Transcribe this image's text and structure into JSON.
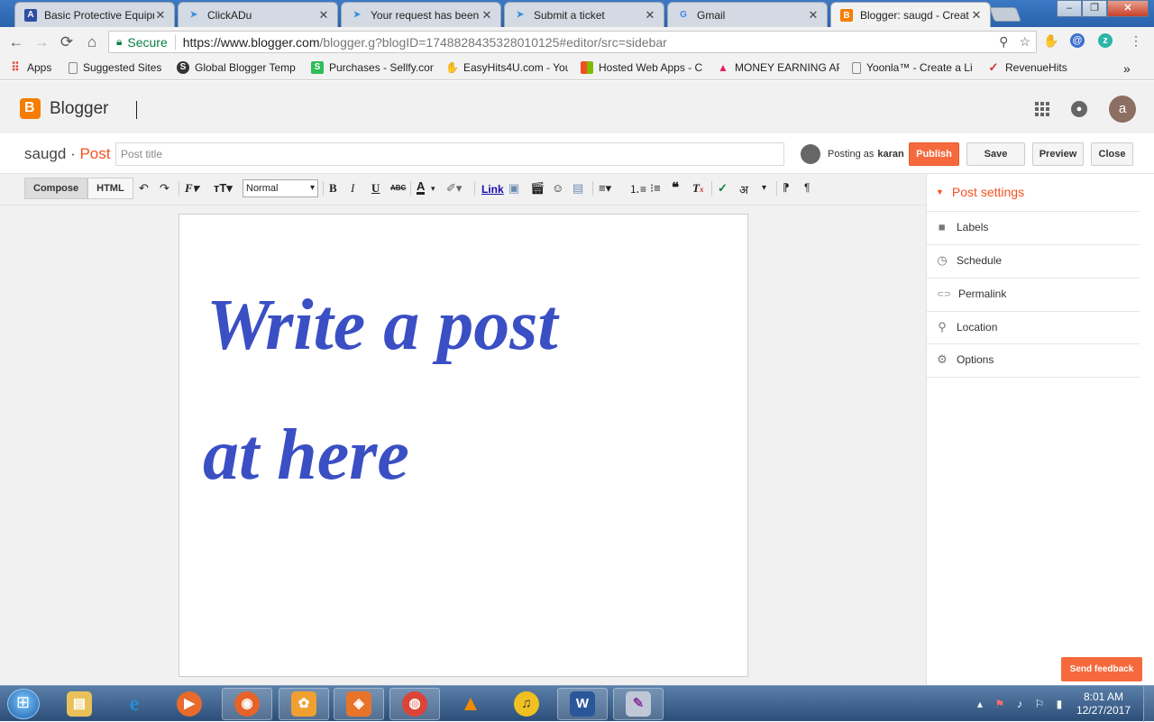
{
  "browser": {
    "tabs": [
      {
        "label": "Basic Protective Equipm",
        "icon": "A",
        "color": "#2c4ea3",
        "active": false
      },
      {
        "label": "ClickADu",
        "icon": "➤",
        "color": "#3a8fd9",
        "active": false
      },
      {
        "label": "Your request has been",
        "icon": "➤",
        "color": "#3a8fd9",
        "active": false
      },
      {
        "label": "Submit a ticket",
        "icon": "➤",
        "color": "#3a8fd9",
        "active": false
      },
      {
        "label": "Gmail",
        "icon": "G",
        "color": "#4285f4",
        "active": false
      },
      {
        "label": "Blogger: saugd - Creat",
        "icon": "B",
        "color": "#f57d00",
        "active": true
      }
    ],
    "close_glyph": "✕",
    "window_buttons": {
      "minimize": "–",
      "maximize": "❐",
      "close": "✕"
    },
    "nav": {
      "back": "←",
      "forward": "→",
      "reload": "⟳",
      "home": "⌂"
    },
    "secure_label": "Secure",
    "url_host": "https://www.blogger.com",
    "url_path": "/blogger.g?blogID=1748828435328010125#editor/src=sidebar",
    "omnibox_icons": {
      "search": "⚲",
      "star": "☆"
    },
    "extensions": [
      "✋",
      "@",
      "z",
      "⋮"
    ],
    "bookmarks": [
      {
        "label": "Apps",
        "icon": "⠿",
        "color": "#e94235"
      },
      {
        "label": "Suggested Sites",
        "icon": "▯",
        "color": "#888888"
      },
      {
        "label": "Global Blogger Temp",
        "icon": "S",
        "color": "#333333"
      },
      {
        "label": "Purchases - Sellfy.con",
        "icon": "S",
        "color": "#2ebd59"
      },
      {
        "label": "EasyHits4U.com - You",
        "icon": "✋",
        "color": "#f2b233"
      },
      {
        "label": "Hosted Web Apps - C",
        "icon": "▦",
        "color": "#f25022"
      },
      {
        "label": "MONEY EARNING AP",
        "icon": "▲",
        "color": "#e91e63"
      },
      {
        "label": "Yoonla™ - Create a Li",
        "icon": "▯",
        "color": "#888888"
      },
      {
        "label": "RevenueHits",
        "icon": "✓",
        "color": "#d32f2f"
      }
    ],
    "bookmarks_more": "»"
  },
  "blogger": {
    "brand": "Blogger",
    "avatar_letter": "a",
    "blog_name": "saugd",
    "separator": "·",
    "page_label": "Post",
    "title_placeholder": "Post title",
    "posting_as_label": "Posting as",
    "posting_as_user": "karan",
    "buttons": {
      "publish": "Publish",
      "save": "Save",
      "preview": "Preview",
      "close": "Close"
    }
  },
  "editor": {
    "modes": {
      "compose": "Compose",
      "html": "HTML"
    },
    "format_select": "Normal",
    "link_label": "Link",
    "body_lines": [
      "Write a post",
      "at here"
    ]
  },
  "post_settings": {
    "heading": "Post settings",
    "items": [
      {
        "label": "Labels",
        "icon": "⬥"
      },
      {
        "label": "Schedule",
        "icon": "◷"
      },
      {
        "label": "Permalink",
        "icon": "⊂⊃"
      },
      {
        "label": "Location",
        "icon": "⚲"
      },
      {
        "label": "Options",
        "icon": "⚙"
      }
    ]
  },
  "feedback_button": "Send feedback",
  "taskbar": {
    "clock_time": "8:01 AM",
    "clock_date": "12/27/2017",
    "apps": [
      {
        "name": "explorer",
        "glyph": "▤",
        "color": "#e8c15a"
      },
      {
        "name": "internet-explorer",
        "glyph": "e",
        "color": "#2a8ad6"
      },
      {
        "name": "media-player",
        "glyph": "▶",
        "color": "#e86a2c"
      },
      {
        "name": "firefox",
        "glyph": "◉",
        "color": "#e6632a"
      },
      {
        "name": "uc-browser",
        "glyph": "✿",
        "color": "#f0a030"
      },
      {
        "name": "app-orange",
        "glyph": "◈",
        "color": "#e8742a"
      },
      {
        "name": "chrome",
        "glyph": "◍",
        "color": "#db4437"
      },
      {
        "name": "vlc",
        "glyph": "▲",
        "color": "#f08a00"
      },
      {
        "name": "audio-app",
        "glyph": "♫",
        "color": "#f0c020"
      },
      {
        "name": "word",
        "glyph": "W",
        "color": "#2b579a"
      },
      {
        "name": "paint",
        "glyph": "✎",
        "color": "#c0c8d8"
      }
    ],
    "tray_icons": [
      "▴",
      "⚑",
      "♪",
      "⚐",
      "▮"
    ]
  }
}
